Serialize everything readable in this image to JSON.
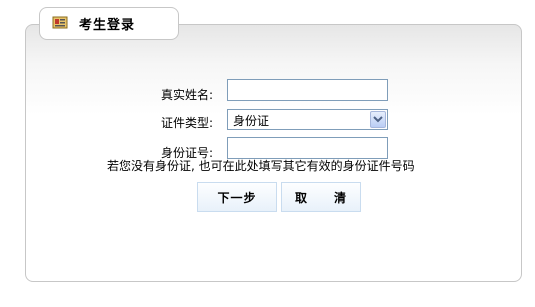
{
  "header": {
    "title": "考生登录",
    "icon": "id-card-icon"
  },
  "form": {
    "name_label": "真实姓名:",
    "name_value": "",
    "id_type_label": "证件类型:",
    "id_type_selected": "身份证",
    "id_number_label": "身份证号:",
    "id_number_value": "",
    "hint": "若您没有身份证, 也可在此处填写其它有效的身份证件号码"
  },
  "buttons": {
    "next_label": "下一步",
    "cancel_label": "取　　清"
  }
}
